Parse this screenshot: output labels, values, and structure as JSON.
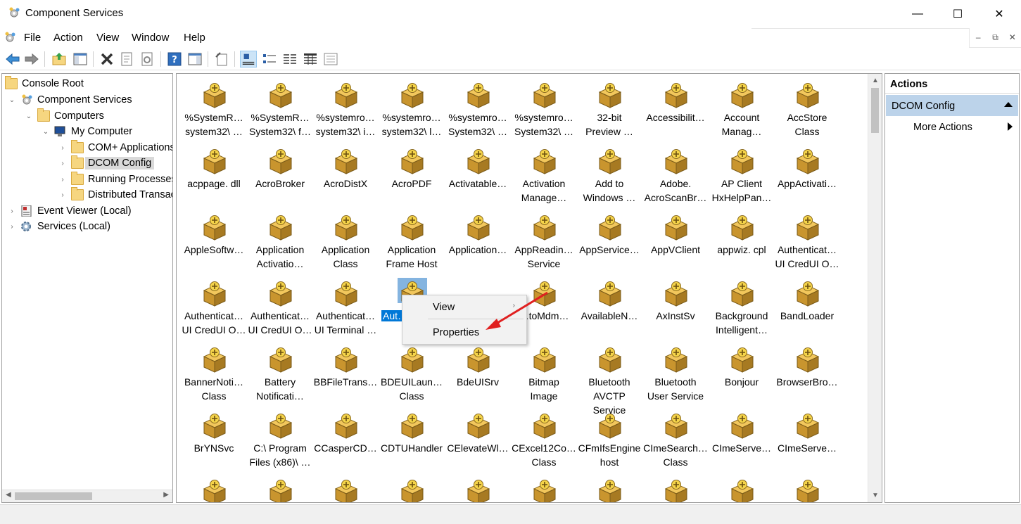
{
  "window": {
    "title": "Component Services",
    "minimize": "—",
    "maximize": "☐",
    "close": "✕"
  },
  "menu": {
    "items": [
      "File",
      "Action",
      "View",
      "Window",
      "Help"
    ]
  },
  "mdi": {
    "minimize": "–",
    "restore": "⧉",
    "close": "✕"
  },
  "toolbar": {
    "icons": [
      "back-icon",
      "forward-icon",
      "up-folder-icon",
      "show-hide-console-tree-icon",
      "delete-icon",
      "properties-icon",
      "refresh-icon",
      "help-icon",
      "show-hide-action-pane-icon",
      "export-list-icon",
      "large-icons-view-icon",
      "small-icons-view-icon",
      "list-view-icon",
      "details-view-icon",
      "configure-view-icon"
    ]
  },
  "tree": {
    "items": [
      {
        "label": "Console Root",
        "level": 0,
        "icon": "folder-icon",
        "twist": ""
      },
      {
        "label": "Component Services",
        "level": 1,
        "icon": "component-services-icon",
        "twist": "⌄"
      },
      {
        "label": "Computers",
        "level": 2,
        "icon": "folder-icon",
        "twist": "⌄"
      },
      {
        "label": "My Computer",
        "level": 3,
        "icon": "computer-icon",
        "twist": "⌄"
      },
      {
        "label": "COM+ Applications",
        "level": 4,
        "icon": "folder-icon",
        "twist": "›"
      },
      {
        "label": "DCOM Config",
        "level": 4,
        "icon": "folder-icon",
        "twist": "›",
        "selected": true
      },
      {
        "label": "Running Processes",
        "level": 4,
        "icon": "folder-icon",
        "twist": "›"
      },
      {
        "label": "Distributed Transaction Coordinator",
        "level": 4,
        "icon": "folder-icon",
        "twist": "›"
      },
      {
        "label": "Event Viewer (Local)",
        "level": 1,
        "icon": "event-viewer-icon",
        "twist": "›"
      },
      {
        "label": "Services (Local)",
        "level": 1,
        "icon": "services-gear-icon",
        "twist": "›"
      }
    ]
  },
  "components": [
    [
      "%SystemR…\nsystem32\\ …",
      "%SystemR…\nSystem32\\ f…",
      "%systemro…\nsystem32\\ i…",
      "%systemro…\nsystem32\\ l…",
      "%systemro…\nSystem32\\ …",
      "%systemro…\nSystem32\\ …",
      "32-bit\nPreview …",
      "Accessibilit…",
      "Account\nManag…",
      "AccStore\nClass"
    ],
    [
      "acppage. dll",
      "AcroBroker",
      "AcroDistX",
      "AcroPDF",
      "Activatable…",
      "Activation\nManage…",
      "Add to\nWindows …",
      "Adobe.\nAcroScanBr…",
      "AP Client\nHxHelpPan…",
      "AppActivati…"
    ],
    [
      "AppleSoftw…",
      "Application\nActivatio…",
      "Application\nClass",
      "Application\nFrame Host",
      "Application…",
      "AppReadin…\nService",
      "AppService…",
      "AppVClient",
      "appwiz. cpl",
      "Authenticat…\nUI CredUI O…"
    ],
    [
      "Authenticat…\nUI CredUI O…",
      "Authenticat…\nUI CredUI O…",
      "Authenticat…\nUI Terminal …",
      "Aut…",
      "",
      "…toMdm…",
      "AvailableN…",
      "AxInstSv",
      "Background\nIntelligent…",
      "BandLoader"
    ],
    [
      "BannerNoti…\nClass",
      "Battery\nNotificati…",
      "BBFileTrans…",
      "BDEUILaun…\nClass",
      "BdeUISrv",
      "Bitmap\nImage",
      "Bluetooth\nAVCTP Service",
      "Bluetooth\nUser Service",
      "Bonjour",
      "BrowserBro…"
    ],
    [
      "BrYNSvc",
      "C:\\ Program\nFiles (x86)\\ …",
      "CCasperCD…",
      "CDTUHandler",
      "CElevateWl…",
      "CExcel12Co…\nClass",
      "CFmIfsEngine\nhost",
      "CImeSearch…\nClass",
      "CImeServe…",
      "CImeServe…"
    ],
    [
      "",
      "",
      "",
      "",
      "",
      "",
      "",
      "",
      "",
      ""
    ]
  ],
  "context_menu": {
    "view": "View",
    "view_arrow": "›",
    "properties": "Properties"
  },
  "actions": {
    "title": "Actions",
    "section": "DCOM Config",
    "more": "More Actions"
  },
  "colors": {
    "selection": "#0078d7",
    "action_section": "#bcd3ea",
    "annotation_arrow": "#e02020",
    "package_gold": "#d9a43a"
  }
}
